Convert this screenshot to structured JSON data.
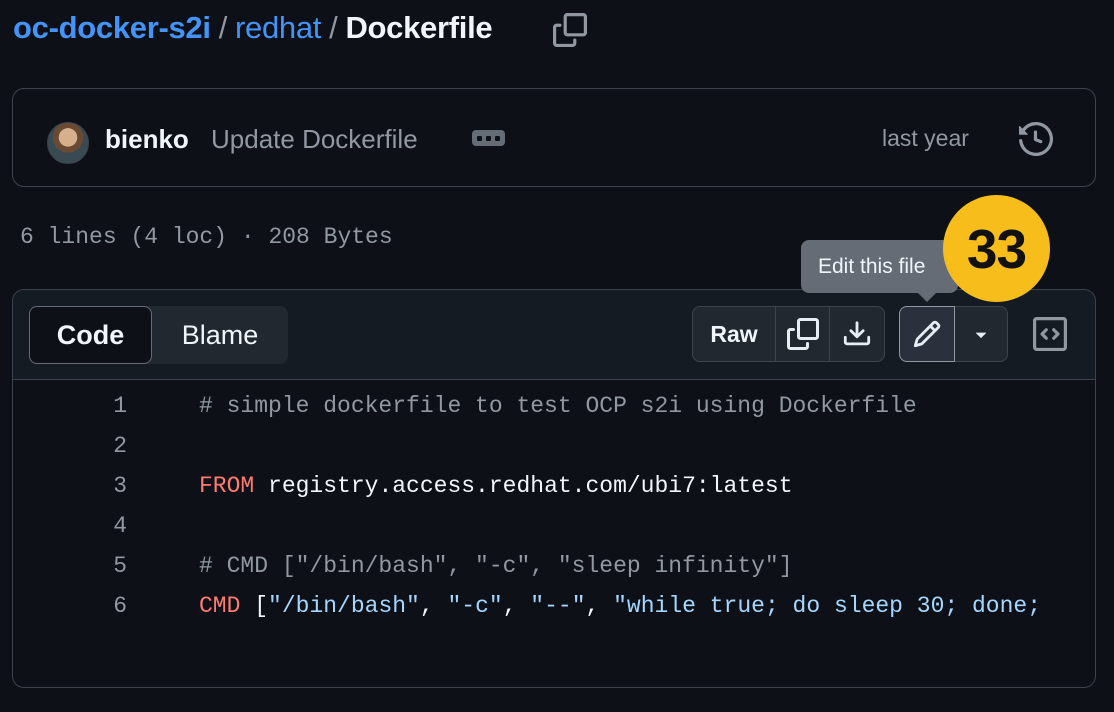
{
  "breadcrumb": {
    "repo": "oc-docker-s2i",
    "separator": "/",
    "folder": "redhat",
    "file": "Dockerfile"
  },
  "commit": {
    "author": "bienko",
    "message": "Update Dockerfile",
    "time": "last year"
  },
  "file_info": "6 lines (4 loc) · 208 Bytes",
  "view_tabs": {
    "code": "Code",
    "blame": "Blame"
  },
  "toolbar": {
    "raw": "Raw"
  },
  "tooltip": "Edit this file",
  "badge": "33",
  "colors": {
    "background": "#0d1117",
    "link": "#4493f8",
    "keyword": "#ff7b72",
    "string": "#a5d6ff",
    "badge": "#f6bd1b"
  },
  "code_lines": [
    {
      "number": "1",
      "tokens": [
        {
          "text": "# simple dockerfile to test OCP s2i using Dockerfile",
          "kind": "comment"
        }
      ]
    },
    {
      "number": "2",
      "tokens": []
    },
    {
      "number": "3",
      "tokens": [
        {
          "text": "FROM",
          "kind": "keyword"
        },
        {
          "text": " registry.access.redhat.com/ubi7:latest",
          "kind": "plain"
        }
      ]
    },
    {
      "number": "4",
      "tokens": []
    },
    {
      "number": "5",
      "tokens": [
        {
          "text": "# CMD [\"/bin/bash\", \"-c\", \"sleep infinity\"]",
          "kind": "comment"
        }
      ]
    },
    {
      "number": "6",
      "tokens": [
        {
          "text": "CMD",
          "kind": "keyword"
        },
        {
          "text": " [",
          "kind": "plain"
        },
        {
          "text": "\"/bin/bash\"",
          "kind": "string"
        },
        {
          "text": ", ",
          "kind": "plain"
        },
        {
          "text": "\"-c\"",
          "kind": "string"
        },
        {
          "text": ", ",
          "kind": "plain"
        },
        {
          "text": "\"--\"",
          "kind": "string"
        },
        {
          "text": ", ",
          "kind": "plain"
        },
        {
          "text": "\"while true; do sleep 30; done;",
          "kind": "string"
        }
      ]
    }
  ]
}
